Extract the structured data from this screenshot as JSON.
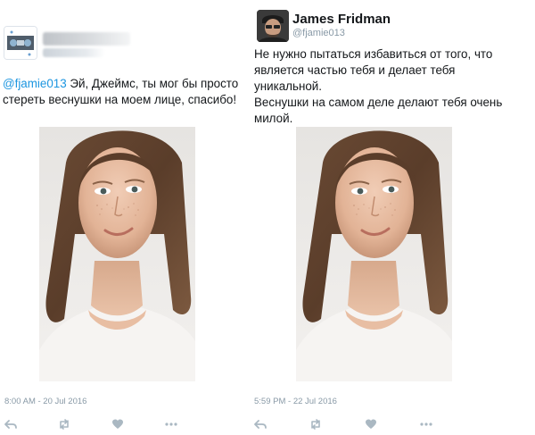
{
  "colors": {
    "link": "#1b95e0",
    "secondary_text": "#8899a6",
    "primary_text": "#14171a",
    "action_icon": "#aab8c2"
  },
  "tweets": [
    {
      "author_name": "",
      "author_handle": "",
      "mention": "@fjamie013",
      "text": " Эй, Джеймс, ты мог бы просто стереть веснушки на моем лице, спасибо!",
      "timestamp": "8:00 AM - 20 Jul 2016",
      "actions": [
        "reply-icon",
        "retweet-icon",
        "like-icon",
        "more-icon"
      ]
    },
    {
      "author_name": "James Fridman",
      "author_handle": "@fjamie013",
      "text_lines": [
        "Не нужно пытаться избавиться от того, что",
        "является частью тебя и делает тебя",
        "уникальной.",
        "Веснушки на самом деле делают тебя очень",
        "милой."
      ],
      "timestamp": "5:59 PM - 22 Jul 2016",
      "actions": [
        "reply-icon",
        "retweet-icon",
        "like-icon",
        "more-icon"
      ]
    }
  ]
}
